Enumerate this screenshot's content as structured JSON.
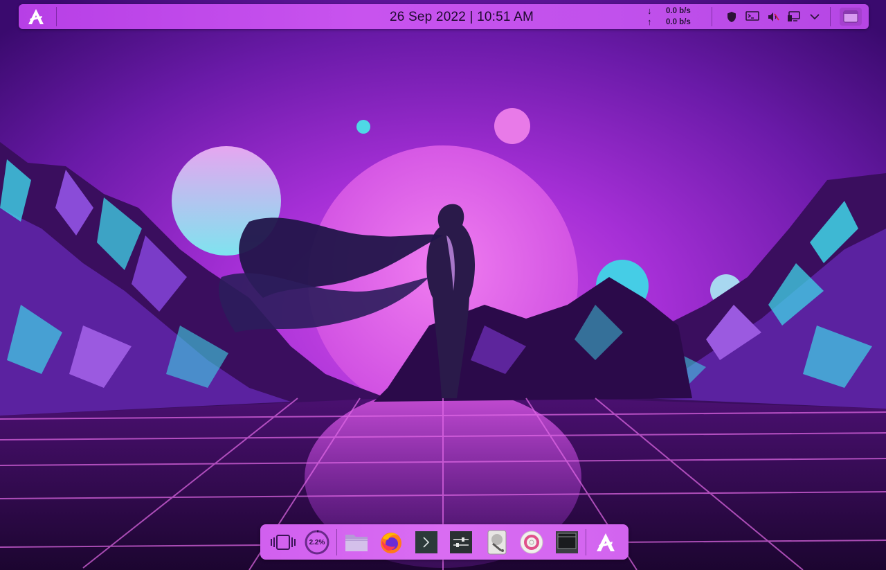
{
  "top_panel": {
    "clock": "26 Sep 2022 | 10:51 AM",
    "net_down_arrow": "↓",
    "net_down": "0.0 b/s",
    "net_up_arrow": "↑",
    "net_up": "0.0 b/s",
    "tray_icons": [
      "shield-icon",
      "terminal-monitor-icon",
      "volume-muted-icon",
      "network-display-icon",
      "chevron-down-icon"
    ]
  },
  "dock": {
    "items": [
      "overview-icon",
      "cpu-monitor",
      "file-manager-icon",
      "firefox-icon",
      "terminal-icon",
      "settings-icon",
      "disk-utility-icon",
      "disc-burner-icon",
      "system-monitor-icon",
      "arcolinux-logo-icon"
    ],
    "cpu_usage": "2.2%"
  },
  "colors": {
    "panel": "#c151ec",
    "dock": "#d96cf2",
    "sky_top": "#3a0a6e",
    "sky_glow": "#c53be0",
    "accent_cyan": "#3fd6e8"
  }
}
